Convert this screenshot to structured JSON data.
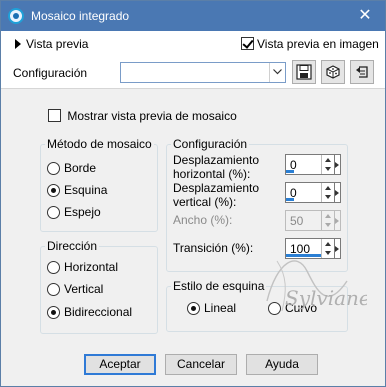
{
  "window": {
    "title": "Mosaico integrado",
    "close_glyph": "✕"
  },
  "preview": {
    "toggle_label": "Vista previa",
    "in_image_label": "Vista previa en imagen",
    "in_image_checked": true
  },
  "config": {
    "label": "Configuración",
    "combo_value": "",
    "tool_icons": [
      "save-icon",
      "dice-icon",
      "reset-icon"
    ]
  },
  "mosaic_preview": {
    "label": "Mostrar vista previa de mosaico",
    "checked": false
  },
  "method": {
    "title": "Método de mosaico",
    "options": [
      "Borde",
      "Esquina",
      "Espejo"
    ],
    "selected": "Esquina"
  },
  "direction": {
    "title": "Dirección",
    "options": [
      "Horizontal",
      "Vertical",
      "Bidireccional"
    ],
    "selected": "Bidireccional"
  },
  "settings": {
    "title": "Configuración",
    "h_offset_label": "Desplazamiento horizontal (%):",
    "h_offset": "0",
    "v_offset_label": "Desplazamiento vertical (%):",
    "v_offset": "0",
    "width_label": "Ancho (%):",
    "width": "50",
    "transition_label": "Transición (%):",
    "transition": "100"
  },
  "corner_style": {
    "title": "Estilo de esquina",
    "options": [
      "Lineal",
      "Curvo"
    ],
    "selected": "Lineal"
  },
  "buttons": {
    "ok": "Aceptar",
    "cancel": "Cancelar",
    "help": "Ayuda"
  },
  "colors": {
    "titlebar": "#4a78b3",
    "accent": "#2a7fd4",
    "dialog_bg": "#f0f0f0"
  }
}
